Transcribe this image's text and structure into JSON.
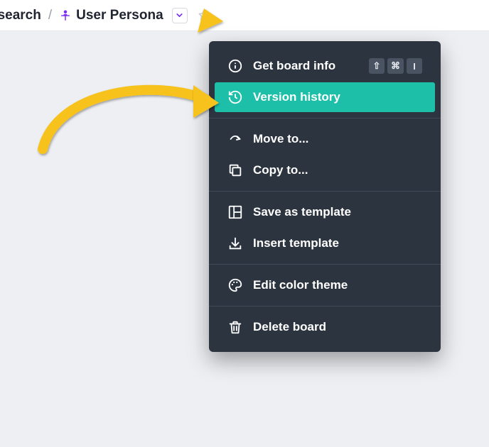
{
  "breadcrumb": {
    "prev_label": "esearch",
    "separator": "/",
    "current_label": "User Persona"
  },
  "menu": {
    "groups": [
      {
        "items": [
          {
            "icon": "info-icon",
            "label": "Get board info",
            "shortcut": [
              "⇧",
              "⌘",
              "I"
            ],
            "highlight": false
          },
          {
            "icon": "history-icon",
            "label": "Version history",
            "shortcut": null,
            "highlight": true
          }
        ]
      },
      {
        "items": [
          {
            "icon": "move-icon",
            "label": "Move to...",
            "shortcut": null,
            "highlight": false
          },
          {
            "icon": "copy-icon",
            "label": "Copy to...",
            "shortcut": null,
            "highlight": false
          }
        ]
      },
      {
        "items": [
          {
            "icon": "template-save-icon",
            "label": "Save as template",
            "shortcut": null,
            "highlight": false
          },
          {
            "icon": "template-insert-icon",
            "label": "Insert template",
            "shortcut": null,
            "highlight": false
          }
        ]
      },
      {
        "items": [
          {
            "icon": "palette-icon",
            "label": "Edit color theme",
            "shortcut": null,
            "highlight": false
          }
        ]
      },
      {
        "items": [
          {
            "icon": "trash-icon",
            "label": "Delete board",
            "shortcut": null,
            "highlight": false
          }
        ]
      }
    ]
  },
  "shortcuts": {
    "shift": "⇧",
    "cmd": "⌘",
    "letter_i": "I"
  },
  "colors": {
    "accent": "#1dbfa9",
    "menu_bg": "#2c3440",
    "persona_purple": "#7b2ff0",
    "annotation": "#f7c21c"
  }
}
